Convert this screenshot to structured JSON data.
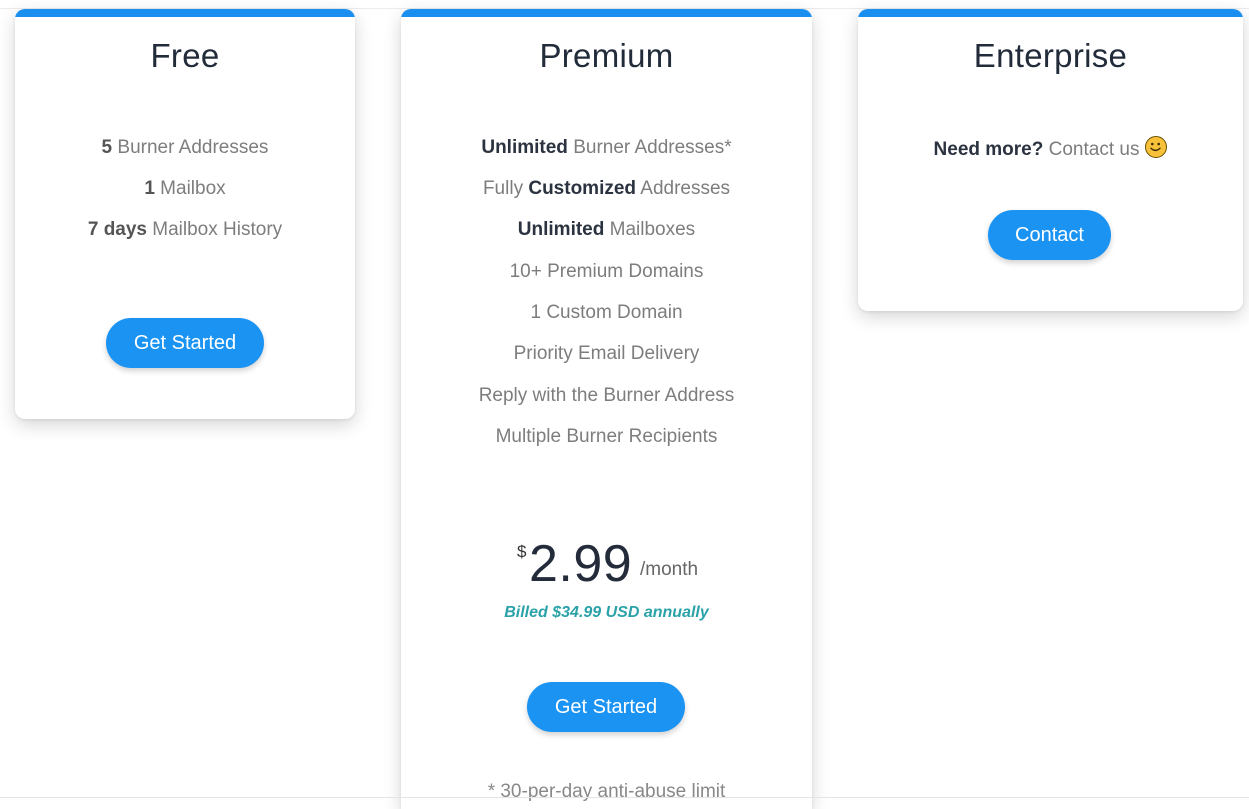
{
  "plans": {
    "free": {
      "title": "Free",
      "features": [
        {
          "bold": "5",
          "text": " Burner Addresses"
        },
        {
          "bold": "1",
          "text": " Mailbox"
        },
        {
          "bold": "7 days",
          "text": " Mailbox History"
        }
      ],
      "button_label": "Get Started"
    },
    "premium": {
      "title": "Premium",
      "features": [
        {
          "pre": "",
          "bold": "Unlimited",
          "post": " Burner Addresses*"
        },
        {
          "pre": "Fully ",
          "bold": "Customized",
          "post": " Addresses"
        },
        {
          "pre": "",
          "bold": "Unlimited",
          "post": " Mailboxes"
        },
        {
          "pre": "10+ Premium Domains",
          "bold": "",
          "post": ""
        },
        {
          "pre": "1 Custom Domain",
          "bold": "",
          "post": ""
        },
        {
          "pre": "Priority Email Delivery",
          "bold": "",
          "post": ""
        },
        {
          "pre": "Reply with the Burner Address",
          "bold": "",
          "post": ""
        },
        {
          "pre": "Multiple Burner Recipients",
          "bold": "",
          "post": ""
        }
      ],
      "price_currency": "$",
      "price_amount": "2.99",
      "price_unit": "/month",
      "billed_note": "Billed $34.99 USD annually",
      "button_label": "Get Started",
      "footnote": "* 30-per-day anti-abuse limit"
    },
    "enterprise": {
      "title": "Enterprise",
      "need_more_bold": "Need more?",
      "need_more_text": " Contact us",
      "button_label": "Contact"
    }
  },
  "colors": {
    "accent_bar": "#1a8ff0",
    "button": "#1a93f3",
    "billed_text": "#2aa2a8",
    "smiley": "#f7c23a"
  },
  "icons": {
    "enterprise_emoji": "smiley-face-icon"
  }
}
